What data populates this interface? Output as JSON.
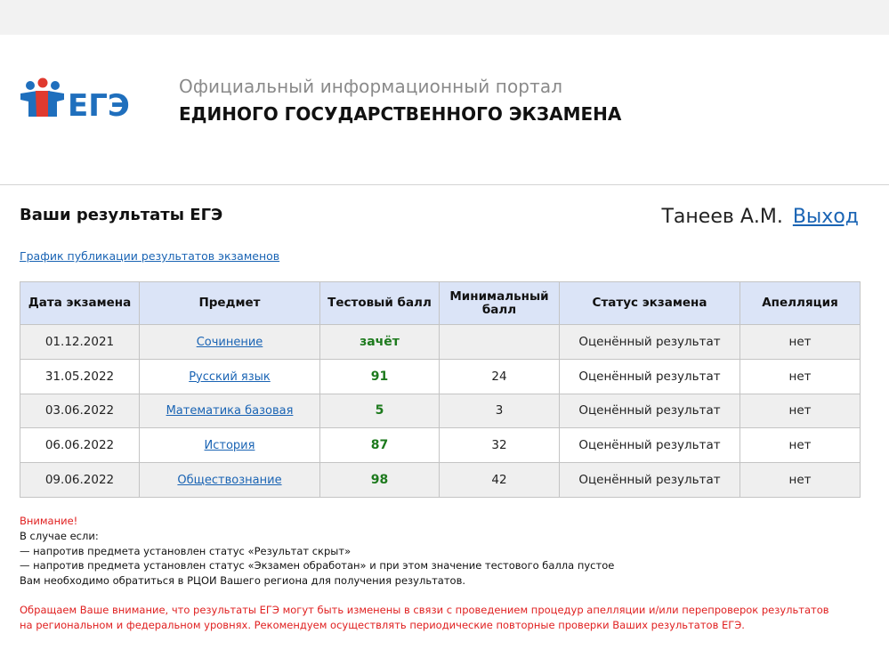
{
  "header": {
    "logo_text": "ЕГЭ",
    "portal_subtitle": "Официальный информационный портал",
    "portal_title": "ЕДИНОГО ГОСУДАРСТВЕННОГО ЭКЗАМЕНА"
  },
  "page": {
    "title": "Ваши результаты ЕГЭ",
    "user_name": "Танеев А.М.",
    "logout_label": "Выход",
    "schedule_link": "График публикации результатов экзаменов"
  },
  "table": {
    "headers": {
      "date": "Дата экзамена",
      "subject": "Предмет",
      "score": "Тестовый балл",
      "min_score": "Минимальный балл",
      "status": "Статус экзамена",
      "appeal": "Апелляция"
    },
    "rows": [
      {
        "date": "01.12.2021",
        "subject": "Сочинение",
        "score": "зачёт",
        "min_score": "",
        "status": "Оценённый результат",
        "appeal": "нет"
      },
      {
        "date": "31.05.2022",
        "subject": "Русский язык",
        "score": "91",
        "min_score": "24",
        "status": "Оценённый результат",
        "appeal": "нет"
      },
      {
        "date": "03.06.2022",
        "subject": "Математика базовая",
        "score": "5",
        "min_score": "3",
        "status": "Оценённый результат",
        "appeal": "нет"
      },
      {
        "date": "06.06.2022",
        "subject": "История",
        "score": "87",
        "min_score": "32",
        "status": "Оценённый результат",
        "appeal": "нет"
      },
      {
        "date": "09.06.2022",
        "subject": "Обществознание",
        "score": "98",
        "min_score": "42",
        "status": "Оценённый результат",
        "appeal": "нет"
      }
    ]
  },
  "notes": {
    "attention": "Внимание!",
    "line1": "В случае если:",
    "line2": "— напротив предмета установлен статус «Результат скрыт»",
    "line3": "— напротив предмета установлен статус «Экзамен обработан» и при этом значение тестового балла пустое",
    "line4": "Вам необходимо обратиться в РЦОИ Вашего региона для получения результатов.",
    "warning1": "Обращаем Ваше внимание, что результаты ЕГЭ могут быть изменены в связи с проведением процедур апелляции и/или перепроверок результатов",
    "warning2": "на региональном и федеральном уровнях. Рекомендуем осуществлять периодические повторные проверки Ваших результатов ЕГЭ."
  },
  "colors": {
    "link": "#1a64b4",
    "score_green": "#1d7a1d",
    "warning_red": "#e02020",
    "header_bg": "#dbe4f7",
    "logo_blue": "#1f6fbd",
    "logo_red": "#e03a2f"
  }
}
